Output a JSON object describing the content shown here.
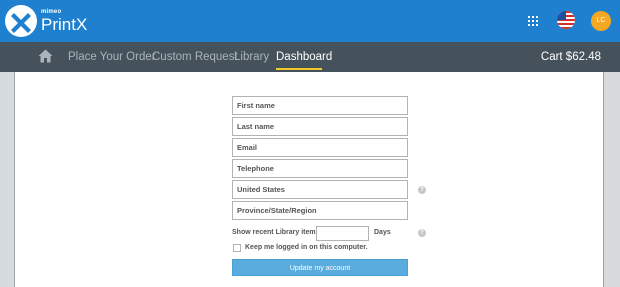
{
  "header": {
    "brand_small": "mimeo",
    "brand_name": "PrintX",
    "avatar_initials": "LC"
  },
  "nav": {
    "items": [
      {
        "label": "Place Your Order"
      },
      {
        "label": "Custom Request"
      },
      {
        "label": "Library"
      },
      {
        "label": "Dashboard",
        "active": true
      }
    ],
    "cart_label": "Cart $62.48"
  },
  "form": {
    "first_name_placeholder": "First name",
    "last_name_placeholder": "Last name",
    "email_placeholder": "Email",
    "telephone_placeholder": "Telephone",
    "country_value": "United States",
    "province_placeholder": "Province/State/Region",
    "recent_items_label": "Show recent Library items:",
    "days_label": "Days",
    "keep_logged_label": "Keep me logged in on this computer.",
    "update_button": "Update my account"
  },
  "colors": {
    "topbar": "#1f80cf",
    "navbar": "#45525b",
    "accent": "#f2c92d",
    "button": "#5aacde",
    "avatar": "#f7a823"
  }
}
